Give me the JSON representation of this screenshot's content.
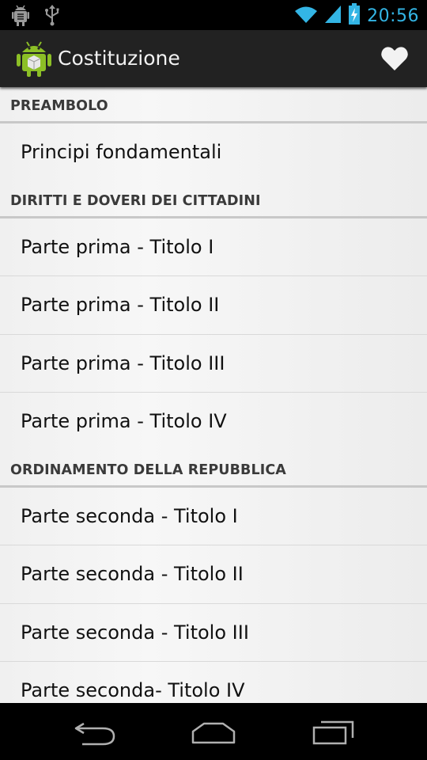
{
  "status_bar": {
    "time": "20:56",
    "icons": [
      "android-debug-icon",
      "usb-icon",
      "wifi-icon",
      "signal-icon",
      "battery-charging-icon"
    ]
  },
  "action_bar": {
    "title": "Costituzione",
    "app_icon": "android-robot-icon",
    "action_icon": "heart-icon"
  },
  "list": {
    "sections": [
      {
        "header": "PREAMBOLO",
        "items": [
          "Principi fondamentali"
        ]
      },
      {
        "header": "DIRITTI E DOVERI DEI CITTADINI",
        "items": [
          "Parte prima - Titolo I",
          "Parte prima - Titolo II",
          "Parte prima - Titolo III",
          "Parte prima - Titolo IV"
        ]
      },
      {
        "header": "ORDINAMENTO DELLA REPUBBLICA",
        "items": [
          "Parte seconda - Titolo I",
          "Parte seconda - Titolo II",
          "Parte seconda - Titolo III",
          "Parte seconda- Titolo IV"
        ]
      }
    ]
  },
  "nav_bar": {
    "buttons": [
      "back-icon",
      "home-icon",
      "recent-apps-icon"
    ]
  },
  "colors": {
    "status_accent": "#33b5e5",
    "action_bar_bg": "#222222",
    "list_bg": "#f2f2f2",
    "header_text": "#3a3a3a",
    "item_text": "#111111"
  }
}
